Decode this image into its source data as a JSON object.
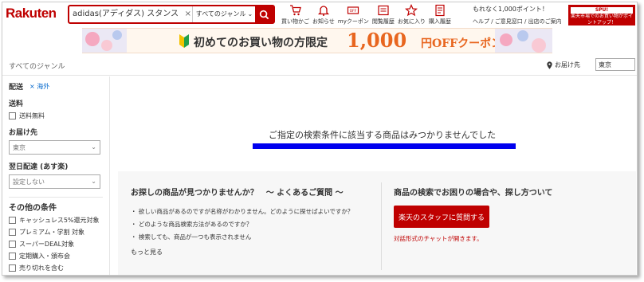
{
  "header": {
    "logo": "Rakuten",
    "search_value": "adidas(アディダス) スタンス",
    "search_clear": "×",
    "genre_select": "すべてのジャンル",
    "nav": [
      {
        "label": "買い物かご",
        "icon": "cart-icon"
      },
      {
        "label": "お知らせ",
        "icon": "bell-icon"
      },
      {
        "label": "myクーポン",
        "icon": "coupon-icon"
      },
      {
        "label": "閲覧履歴",
        "icon": "history-icon"
      },
      {
        "label": "お気に入り",
        "icon": "star-icon"
      },
      {
        "label": "購入履歴",
        "icon": "receipt-icon"
      }
    ],
    "points": "もれなく1,000ポイント！",
    "help": "ヘルプ / ご意見窓口 / 出店のご案内",
    "spu_top": "SPU!",
    "spu_text": "楽天市場でのお買い物がポイントアップ！"
  },
  "coupon": {
    "text": "初めてのお買い物の方限定",
    "amount": "1,000",
    "suffix": "円OFFクーポン",
    "colors": {
      "accent": "#e8661f",
      "bg": "#fff7ee"
    }
  },
  "breadcrumb": {
    "label": "すべてのジャンル",
    "deliver_label": "お届け先",
    "deliver_value": "東京"
  },
  "sidebar": {
    "delivery_title": "配送",
    "overseas": "海外",
    "shipping_title": "送料",
    "free_shipping": "送料無料",
    "dest_title": "お届け先",
    "dest_value": "東京",
    "nextday_title": "翌日配達 (あす楽)",
    "nextday_value": "設定しない",
    "other_title": "その他の条件",
    "options": [
      "キャッシュレス5%還元対象",
      "プレミアム・学割 対象",
      "スーパーDEAL対象",
      "定期購入・頒布会",
      "売り切れを含む"
    ]
  },
  "main": {
    "no_results": "ご指定の検索条件に該当する商品はみつかりませんでした",
    "faq_title": "お探しの商品が見つかりませんか？　～ よくあるご質問 ～",
    "faq": [
      "・ 欲しい商品があるのですが名称がわかりません。どのように探せばよいですか？",
      "・ どのような商品検索方法があるのですか？",
      "・ 検索しても、商品が一つも表示されません"
    ],
    "more": "もっと見る",
    "help_title": "商品の検索でお困りの場合や、探し方ついて",
    "staff_button": "楽天のスタッフに質問する",
    "chat_note": "対話形式のチャットが開きます。"
  },
  "colors": {
    "brand": "#bf0000",
    "link": "#0066cc",
    "highlight": "#0000ee"
  }
}
